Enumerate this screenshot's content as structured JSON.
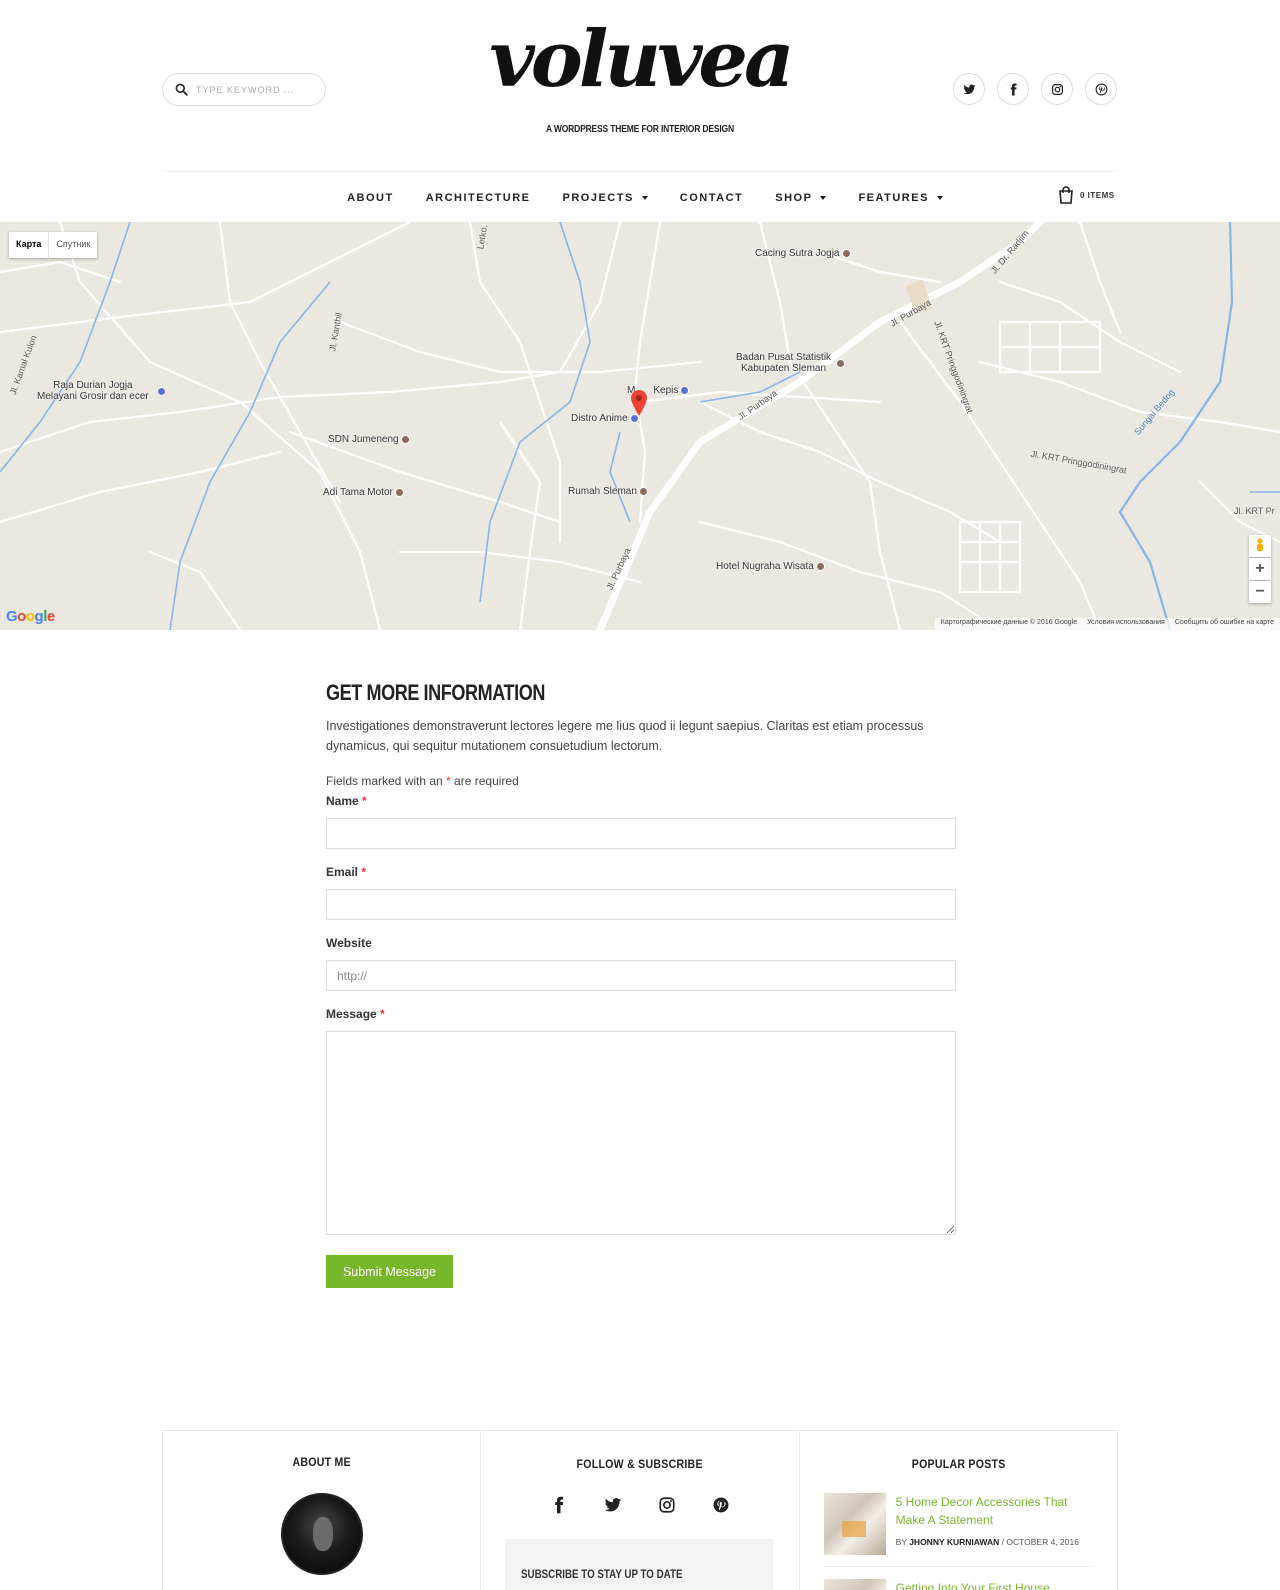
{
  "header": {
    "search_placeholder": "TYPE KEYWORD ...",
    "logo_text": "voluvea",
    "tagline": "A WORDPRESS THEME FOR INTERIOR DESIGN",
    "social": [
      "twitter-icon",
      "facebook-icon",
      "instagram-icon",
      "pinterest-icon"
    ],
    "cart_label": "0 ITEMS"
  },
  "nav": {
    "items": [
      {
        "label": "ABOUT",
        "dropdown": false
      },
      {
        "label": "ARCHITECTURE",
        "dropdown": false
      },
      {
        "label": "PROJECTS",
        "dropdown": true
      },
      {
        "label": "CONTACT",
        "dropdown": false
      },
      {
        "label": "SHOP",
        "dropdown": true
      },
      {
        "label": "FEATURES",
        "dropdown": true
      }
    ]
  },
  "map": {
    "type_map": "Карта",
    "type_satellite": "Спутник",
    "pois": {
      "cacing": "Cacing Sutra Jogja",
      "badan1": "Badan Pusat Statistik",
      "badan2": "Kabupaten Sleman",
      "kepis": "Kepis",
      "kepis_prefix": "M",
      "distro": "Distro Anime",
      "raja1": "Raja Durian Jogja",
      "raja2": "Melayani Grosir dan ecer",
      "sdn": "SDN Jumeneng",
      "adi": "Adi Tama Motor",
      "rumah": "Rumah Sleman",
      "hotel": "Hotel Nugraha Wisata"
    },
    "streets": {
      "purbaya1": "Jl. Purbaya",
      "purbaya2": "Jl. Purbaya",
      "purbaya3": "Jl. Purbaya",
      "radjim": "Jl. Dr. Radjim",
      "krt1": "Jl. KRT Pringgodiningrat",
      "krt2": "Jl. KRT Pringgodiningrat",
      "krt3": "Jl. KRT Pr",
      "kanthil": "Jl. Kanthil",
      "kamal": "Jl. Kamal Kulon",
      "letko": "Letko.",
      "bedog": "Sungai Bedog"
    },
    "zoom_in": "+",
    "zoom_out": "−",
    "google": "Google",
    "attribution": [
      "Картографические данные © 2016 Google",
      "Условия использования",
      "Сообщить об ошибке на карте"
    ]
  },
  "form": {
    "title": "GET MORE INFORMATION",
    "description": "Investigationes demonstraverunt lectores legere me lius quod ii legunt saepius. Claritas est etiam processus dynamicus, qui sequitur mutationem consuetudium lectorum.",
    "required_prefix": "Fields marked with an ",
    "required_star": "*",
    "required_suffix": " are required",
    "name_label": "Name",
    "email_label": "Email",
    "website_label": "Website",
    "website_placeholder": "http://",
    "message_label": "Message",
    "star": "*",
    "submit_label": "Submit Message"
  },
  "footer": {
    "about_title": "ABOUT ME",
    "follow_title": "FOLLOW & SUBSCRIBE",
    "follow_icons": [
      "facebook-icon",
      "twitter-icon",
      "instagram-icon",
      "pinterest-icon"
    ],
    "subscribe_text": "SUBSCRIBE TO STAY UP TO DATE",
    "popular_title": "POPULAR POSTS",
    "posts": [
      {
        "title": "5 Home Decor Accessories That Make A Statement",
        "by": "BY ",
        "author": "JHONNY KURNIAWAN",
        "date": " / OCTOBER 4, 2016"
      },
      {
        "title": "Getting Into Your First House"
      }
    ]
  },
  "colors": {
    "accent": "#77b72a",
    "required": "#e33333",
    "map_bg": "#ebe8e1",
    "water": "#8ab4e8"
  }
}
